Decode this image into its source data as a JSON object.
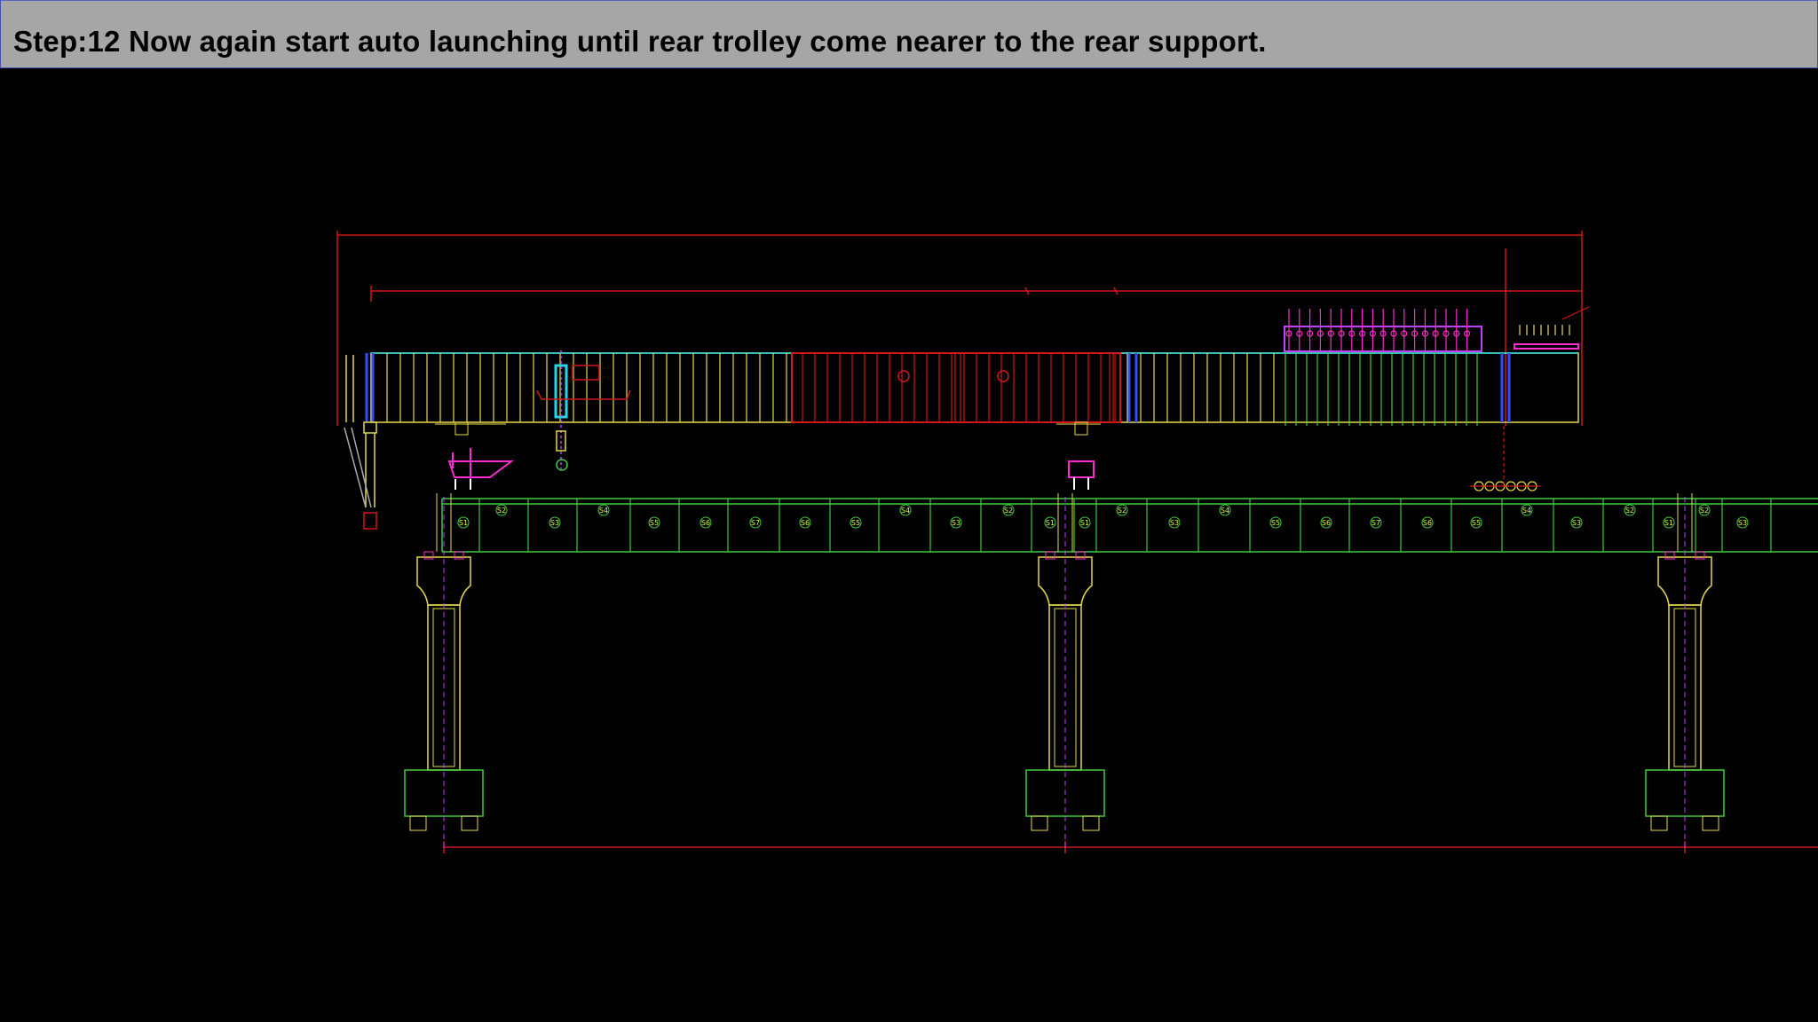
{
  "slide": {
    "title": "Step:12 Now again start auto launching  until rear trolley come nearer to the rear support."
  },
  "colors": {
    "background": "#000000",
    "title_bar": "#a6a6a6",
    "girder": "#3dcc3d",
    "truss": "#e6d84a",
    "dimension": "#d01818",
    "pier": "#e6d84a",
    "trolley": "#ff2bd0",
    "winch": "#26d6e6",
    "hanger": "#c040ff"
  },
  "segments": {
    "span1": [
      "S1",
      "S2",
      "S3",
      "S4",
      "S5",
      "S6",
      "S7",
      "S6",
      "S5",
      "S4",
      "S3",
      "S2",
      "S1"
    ],
    "span2": [
      "S1",
      "S2",
      "S3",
      "S4",
      "S5",
      "S6",
      "S7",
      "S6",
      "S5",
      "S4",
      "S3",
      "S2",
      "S1"
    ],
    "span3": [
      "S2",
      "S3"
    ]
  }
}
